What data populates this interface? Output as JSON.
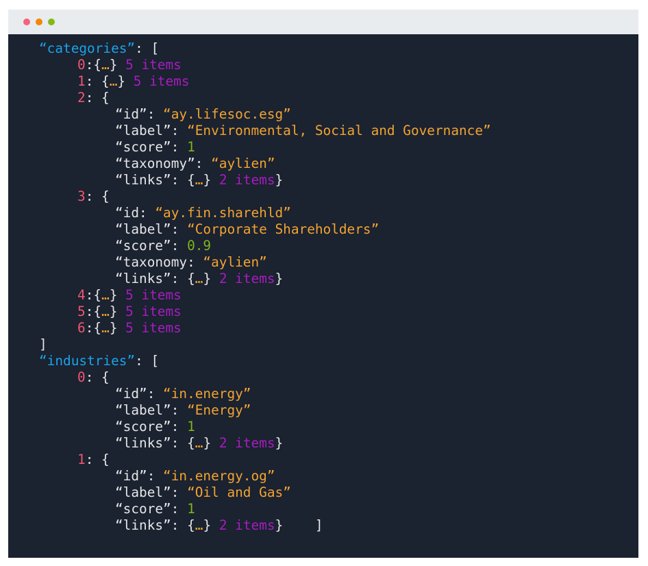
{
  "window": {
    "controls": [
      {
        "name": "close",
        "color": "#f4647a"
      },
      {
        "name": "minimize",
        "color": "#f08a00"
      },
      {
        "name": "maximize",
        "color": "#84b818"
      }
    ]
  },
  "colors": {
    "background": "#1b2230",
    "titlebar": "#e9ecef",
    "top_key": "#1aa3e8",
    "index": "#f0566f",
    "string": "#f2a431",
    "number": "#7fb51c",
    "count": "#a51dbf",
    "text": "#e6e6e6"
  },
  "code": {
    "categories": {
      "key": "“categories”",
      "open": ": [",
      "close": "]",
      "collapsed_top": [
        {
          "index": "0",
          "sep": ":",
          "body": "{…}",
          "count": " 5 items"
        },
        {
          "index": "1",
          "sep": ": ",
          "body": "{…}",
          "count": " 5 items"
        }
      ],
      "item2": {
        "index": "2",
        "open": ": {",
        "id_key": "“id”: ",
        "id_val": "“ay.lifesoc.esg”",
        "label_key": "“label”: ",
        "label_val": "“Environmental, Social and Governance”",
        "score_key": "“score”: ",
        "score_val": "1",
        "taxonomy_key": "“taxonomy”: ",
        "taxonomy_val": "“aylien”",
        "links_key": "“links”: ",
        "links_body": "{…}",
        "links_count": " 2 items",
        "links_close": "}"
      },
      "item3": {
        "index": "3",
        "open": ": {",
        "id_key": "“id: ",
        "id_val": "“ay.fin.sharehld”",
        "label_key": "“label”: ",
        "label_val": "“Corporate Shareholders”",
        "score_key": "“score”: ",
        "score_val": "0.9",
        "taxonomy_key": "“taxonomy: ",
        "taxonomy_val": "“aylien”",
        "links_key": "“links”: ",
        "links_body": "{…}",
        "links_count": " 2 items",
        "links_close": "}"
      },
      "collapsed_bottom": [
        {
          "index": "4",
          "sep": ":",
          "body": "{…}",
          "count": " 5 items"
        },
        {
          "index": "5",
          "sep": ":",
          "body": "{…}",
          "count": " 5 items"
        },
        {
          "index": "6",
          "sep": ":",
          "body": "{…}",
          "count": " 5 items"
        }
      ]
    },
    "industries": {
      "key": "“industries”",
      "open": ": [",
      "close": "]",
      "item0": {
        "index": "0",
        "open": ": {",
        "id_key": "“id”: ",
        "id_val": "“in.energy”",
        "label_key": "“label”: ",
        "label_val": "“Energy”",
        "score_key": "“score”: ",
        "score_val": "1",
        "links_key": "“links”: ",
        "links_body": "{…}",
        "links_count": " 2 items",
        "links_close": "}"
      },
      "item1": {
        "index": "1",
        "open": ": {",
        "id_key": "“id”: ",
        "id_val": "“in.energy.og”",
        "label_key": "“label”: ",
        "label_val": "“Oil and Gas”",
        "score_key": "“score”: ",
        "score_val": "1",
        "links_key": "“links”: ",
        "links_body": "{…}",
        "links_count": " 2 items",
        "links_close": "}",
        "trailing_close": "    ]"
      }
    }
  }
}
